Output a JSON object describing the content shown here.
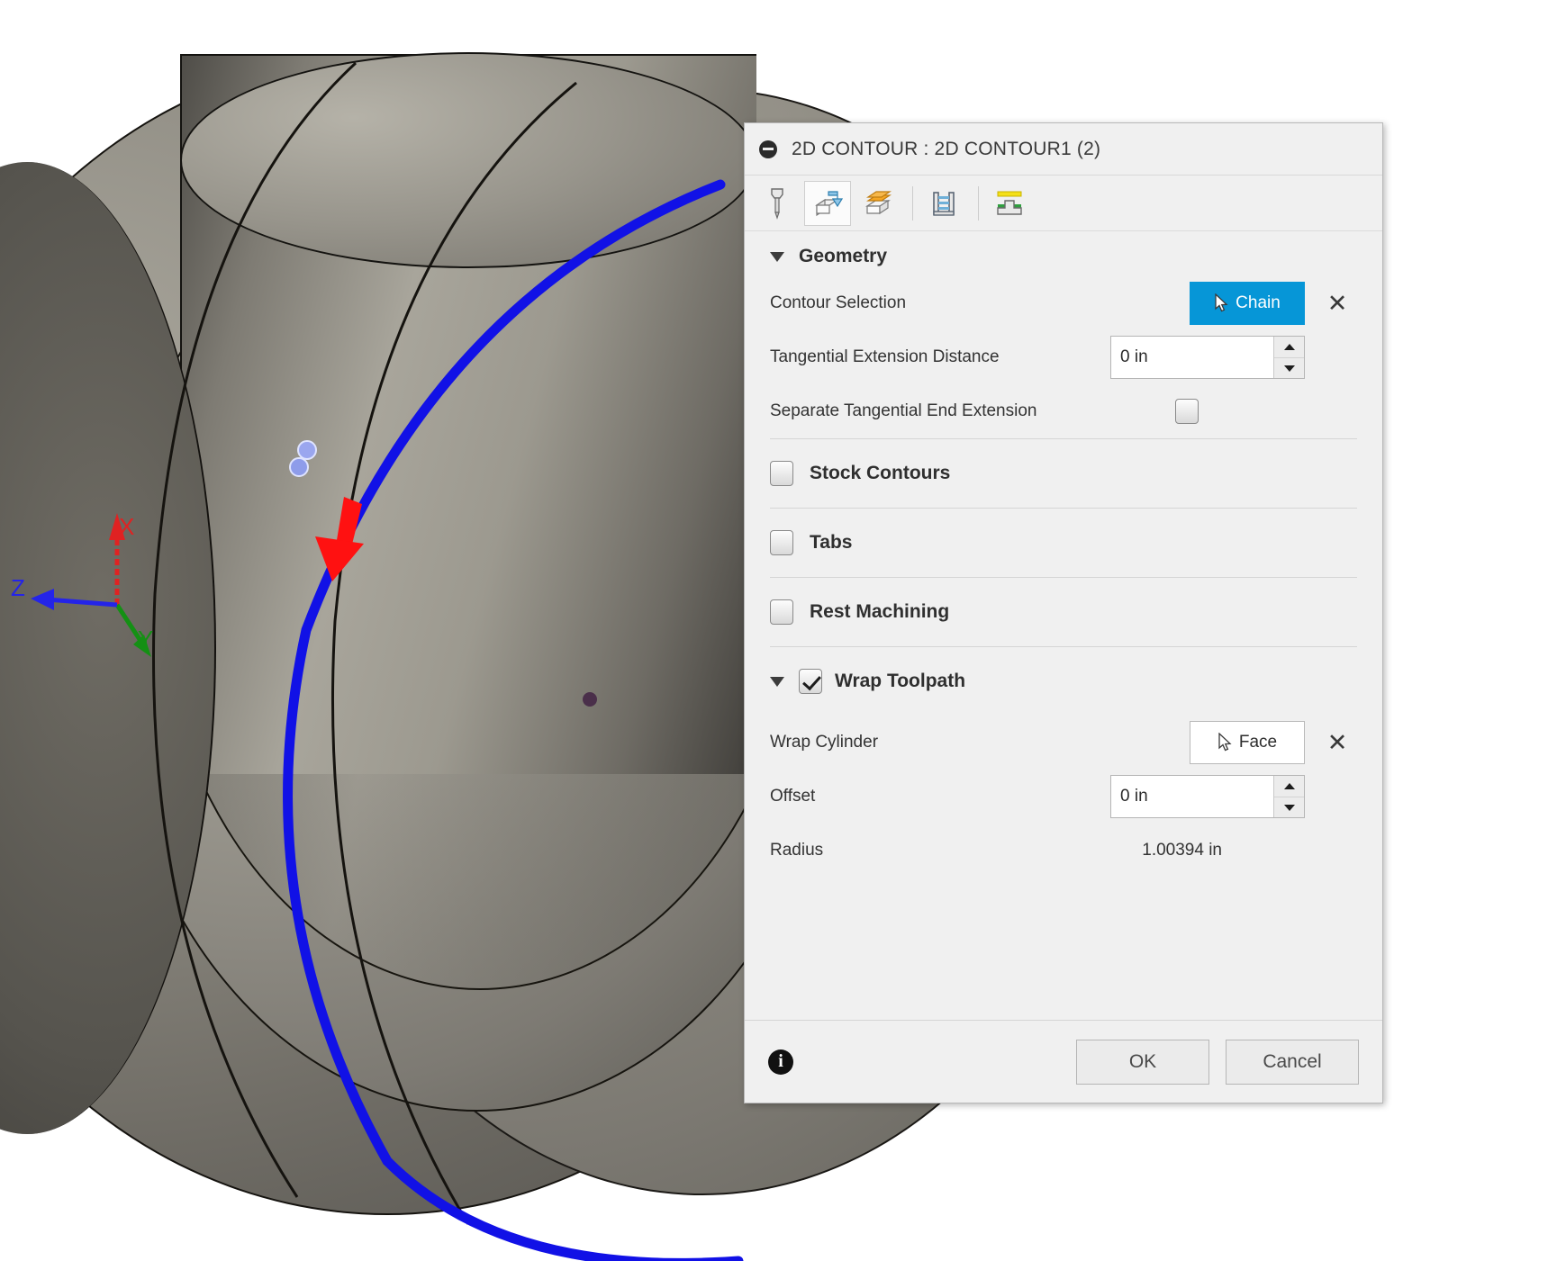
{
  "viewport": {
    "axes": [
      {
        "name": "x-axis",
        "label": "X",
        "color": "#e02222"
      },
      {
        "name": "y-axis",
        "label": "Y",
        "color": "#149014"
      },
      {
        "name": "z-axis",
        "label": "Z",
        "color": "#2424e8"
      }
    ],
    "contour_color": "#1111e6",
    "direction_arrow_color": "#ff1111"
  },
  "dialog": {
    "title": "2D CONTOUR : 2D CONTOUR1 (2)",
    "tabs": [
      {
        "name": "tab-tool",
        "icon": "tool-icon",
        "selected": false
      },
      {
        "name": "tab-geometry",
        "icon": "geometry-icon",
        "selected": true
      },
      {
        "name": "tab-heights",
        "icon": "heights-icon",
        "selected": false
      },
      {
        "name": "tab-passes",
        "icon": "passes-icon",
        "selected": false
      },
      {
        "name": "tab-linking",
        "icon": "linking-icon",
        "selected": false
      }
    ],
    "geometry": {
      "header": "Geometry",
      "expanded": true,
      "contour_selection": {
        "label": "Contour Selection",
        "button": "Chain",
        "button_active": true,
        "accent": "#0696d7",
        "clear": "✕"
      },
      "tangential_extension": {
        "label": "Tangential Extension Distance",
        "value": "0 in",
        "placeholder": "0 in"
      },
      "separate_end_extension": {
        "label": "Separate Tangential End Extension",
        "checked": false
      }
    },
    "groups": [
      {
        "name": "stock-contours",
        "label": "Stock Contours",
        "checked": false
      },
      {
        "name": "tabs-group",
        "label": "Tabs",
        "checked": false
      },
      {
        "name": "rest-machining",
        "label": "Rest Machining",
        "checked": false
      }
    ],
    "wrap_toolpath": {
      "header": "Wrap Toolpath",
      "checked": true,
      "expanded": true,
      "wrap_cylinder": {
        "label": "Wrap Cylinder",
        "button": "Face",
        "button_active": false,
        "clear": "✕"
      },
      "offset": {
        "label": "Offset",
        "value": "0 in",
        "placeholder": "0 in"
      },
      "radius": {
        "label": "Radius",
        "value": "1.00394 in"
      }
    },
    "footer": {
      "info": "i",
      "ok": "OK",
      "cancel": "Cancel"
    }
  }
}
